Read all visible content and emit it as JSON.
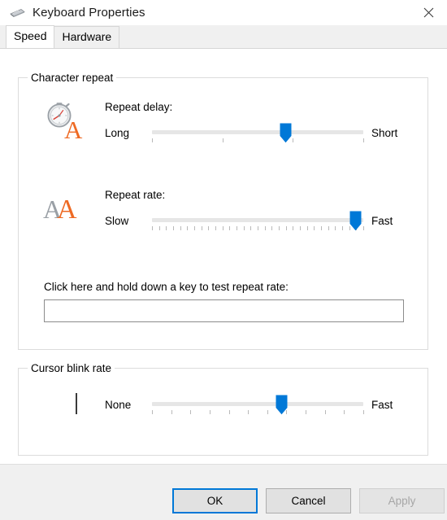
{
  "window": {
    "title": "Keyboard Properties",
    "icon": "keyboard-icon",
    "close_label": "✕"
  },
  "tabs": [
    {
      "label": "Speed",
      "active": true
    },
    {
      "label": "Hardware",
      "active": false
    }
  ],
  "groups": {
    "character_repeat": {
      "title": "Character repeat",
      "repeat_delay": {
        "label": "Repeat delay:",
        "icon": "stopwatch-letter-a-icon",
        "min_label": "Long",
        "max_label": "Short",
        "ticks": 4,
        "value_percent": 63
      },
      "repeat_rate": {
        "label": "Repeat rate:",
        "icon": "double-letter-a-icon",
        "min_label": "Slow",
        "max_label": "Fast",
        "ticks": 31,
        "value_percent": 96
      },
      "test": {
        "label": "Click here and hold down a key to test repeat rate:",
        "value": "",
        "placeholder": ""
      }
    },
    "cursor_blink": {
      "title": "Cursor blink rate",
      "icon": "text-caret-icon",
      "min_label": "None",
      "max_label": "Fast",
      "ticks": 12,
      "value_percent": 61
    }
  },
  "buttons": {
    "ok": "OK",
    "cancel": "Cancel",
    "apply": "Apply"
  },
  "colors": {
    "accent": "#0078d7",
    "track": "#e6e6e6",
    "tick": "#b9b9b9",
    "dialog_bg": "#ffffff",
    "bar_bg": "#f0f0f0"
  }
}
